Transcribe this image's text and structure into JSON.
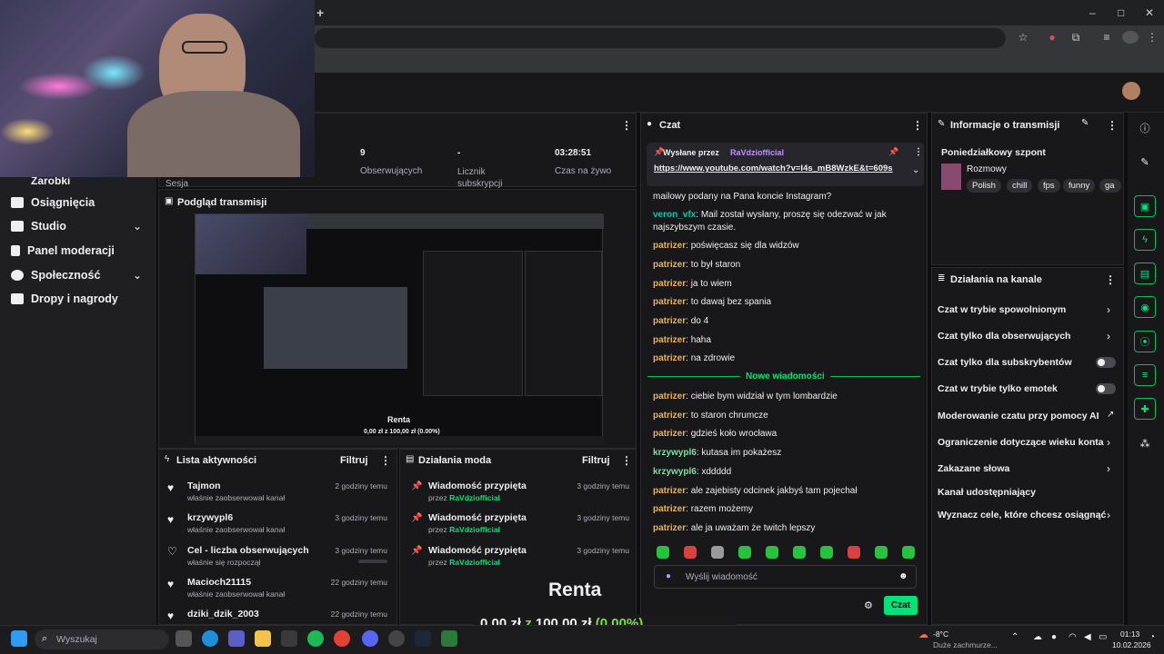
{
  "browser": {
    "new_tab": "+",
    "min": "‒",
    "max": "□",
    "close": "✕"
  },
  "stats": {
    "session_label": "Sesja",
    "earnings_label": "Zarobki",
    "followers_value": "9",
    "followers_label": "Obserwujących",
    "subs_value": "-",
    "subs_label": "Licznik subskrypcji",
    "time_value": "03:28:51",
    "time_label": "Czas na żywo"
  },
  "nav": {
    "items": [
      {
        "label": "Osiągnięcia"
      },
      {
        "label": "Studio"
      },
      {
        "label": "Panel moderacji"
      },
      {
        "label": "Społeczność"
      },
      {
        "label": "Dropy i nagrody"
      }
    ]
  },
  "preview": {
    "title": "Podgląd transmisji",
    "inner_renta": "Renta",
    "inner_amount": "0,00 zł z 100,00 zł (0.00%)"
  },
  "activity": {
    "title": "Lista aktywności",
    "filter": "Filtruj",
    "items": [
      {
        "name": "Tajmon",
        "sub": "właśnie zaobserwował kanał",
        "time": "2 godziny temu"
      },
      {
        "name": "krzywypl6",
        "sub": "właśnie zaobserwował kanał",
        "time": "3 godziny temu"
      },
      {
        "name": "Cel - liczba obserwujących",
        "sub": "właśnie się rozpoczął",
        "time": "3 godziny temu"
      },
      {
        "name": "Macioch21115",
        "sub": "właśnie zaobserwował kanał",
        "time": "22 godziny temu"
      },
      {
        "name": "dziki_dzik_2003",
        "sub": "",
        "time": "22 godziny temu"
      }
    ]
  },
  "mod_actions": {
    "title": "Działania moda",
    "filter": "Filtruj",
    "items": [
      {
        "title": "Wiadomość przypięta",
        "by": "przez",
        "user": "RaVdziofficial",
        "time": "3 godziny temu"
      },
      {
        "title": "Wiadomość przypięta",
        "by": "przez",
        "user": "RaVdziofficial",
        "time": "3 godziny temu"
      },
      {
        "title": "Wiadomość przypięta",
        "by": "przez",
        "user": "RaVdziofficial",
        "time": "3 godziny temu"
      }
    ]
  },
  "goal": {
    "title": "Renta",
    "current": "0,00 zł",
    "sep": "z",
    "target": "100,00 zł",
    "percent": "(0.00%)"
  },
  "chat": {
    "title": "Czat",
    "pinned_label": "Wysłane przez",
    "pinned_user": "RaVdziofficial",
    "pinned_link": "https://www.youtube.com/watch?v=I4s_mB8WzkE&t=609s",
    "partial_line": "mailowy podany na Pana koncie Instagram?",
    "messages_before": [
      {
        "user": "veron_vfx",
        "text": "Mail został wysłany, proszę się odezwać w jak najszybszym czasie."
      },
      {
        "user": "patrizer",
        "text": "poświęcasz się dla widzów"
      },
      {
        "user": "patrizer",
        "text": "to był staron"
      },
      {
        "user": "patrizer",
        "text": "ja to wiem"
      },
      {
        "user": "patrizer",
        "text": "to dawaj bez spania"
      },
      {
        "user": "patrizer",
        "text": "do 4"
      },
      {
        "user": "patrizer",
        "text": "haha"
      },
      {
        "user": "patrizer",
        "text": "na zdrowie"
      }
    ],
    "new_messages": "Nowe wiadomości",
    "messages_after": [
      {
        "user": "patrizer",
        "text": "ciebie bym widział w tym lombardzie"
      },
      {
        "user": "patrizer",
        "text": "to staron chrumcze"
      },
      {
        "user": "patrizer",
        "text": "gdzieś koło wrocława"
      },
      {
        "user": "krzywypl6",
        "text": "kutasa im pokażesz"
      },
      {
        "user": "krzywypl6",
        "text": "xddddd"
      },
      {
        "user": "patrizer",
        "text": "ale zajebisty odcinek jakbyś tam pojechał"
      },
      {
        "user": "patrizer",
        "text": "razem możemy"
      },
      {
        "user": "patrizer",
        "text": "ale ja uważam że twitch lepszy"
      }
    ],
    "input_placeholder": "Wyślij wiadomość",
    "send_label": "Czat"
  },
  "stream_info": {
    "title": "Informacje o transmisji",
    "stream_title": "Poniedziałkowy szpont",
    "category": "Rozmowy",
    "tags": [
      "Polish",
      "chill",
      "fps",
      "funny",
      "ga"
    ]
  },
  "channel_actions": {
    "title": "Działania na kanale",
    "items": [
      {
        "label": "Czat w trybie spowolnionym",
        "control": "arrow"
      },
      {
        "label": "Czat tylko dla obserwujących",
        "control": "arrow"
      },
      {
        "label": "Czat tylko dla subskrybentów",
        "control": "toggle"
      },
      {
        "label": "Czat w trybie tylko emotek",
        "control": "toggle"
      },
      {
        "label": "Moderowanie czatu przy pomocy AI",
        "control": "external"
      },
      {
        "label": "Ograniczenie dotyczące wieku konta",
        "control": "arrow"
      },
      {
        "label": "Zakazane słowa",
        "control": "arrow"
      },
      {
        "label": "Kanał udostępniający",
        "control": "none"
      },
      {
        "label": "Wyznacz cele, które chcesz osiągnąć",
        "control": "arrow"
      }
    ]
  },
  "taskbar": {
    "search_placeholder": "Wyszukaj",
    "weather_temp": "-8°C",
    "weather_desc": "Duże zachmurze...",
    "time": "01:13",
    "date": "10.02.2026"
  },
  "colors": {
    "accent": "#00e37a",
    "bg": "#0e0e10",
    "panel": "#18181b"
  }
}
